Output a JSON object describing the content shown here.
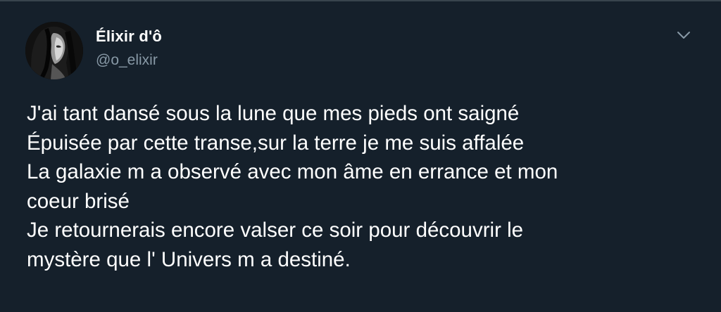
{
  "author": {
    "display_name": "Élixir d'ô",
    "handle": "@o_elixir"
  },
  "tweet": {
    "lines": [
      "J'ai tant dansé sous la lune que mes pieds ont saigné",
      "Épuisée par cette transe,sur la terre je me suis affalée",
      "La galaxie m a observé avec mon âme en errance et mon",
      "coeur brisé",
      "Je retournerais encore valser ce soir pour découvrir le",
      "mystère que l' Univers m a destiné."
    ]
  },
  "icons": {
    "menu": "chevron-down-icon",
    "avatar": "profile-photo"
  },
  "colors": {
    "background": "#15202b",
    "primary_text": "#ffffff",
    "secondary_text": "#8899a6",
    "icon": "#8899a6",
    "divider": "#38444d"
  }
}
